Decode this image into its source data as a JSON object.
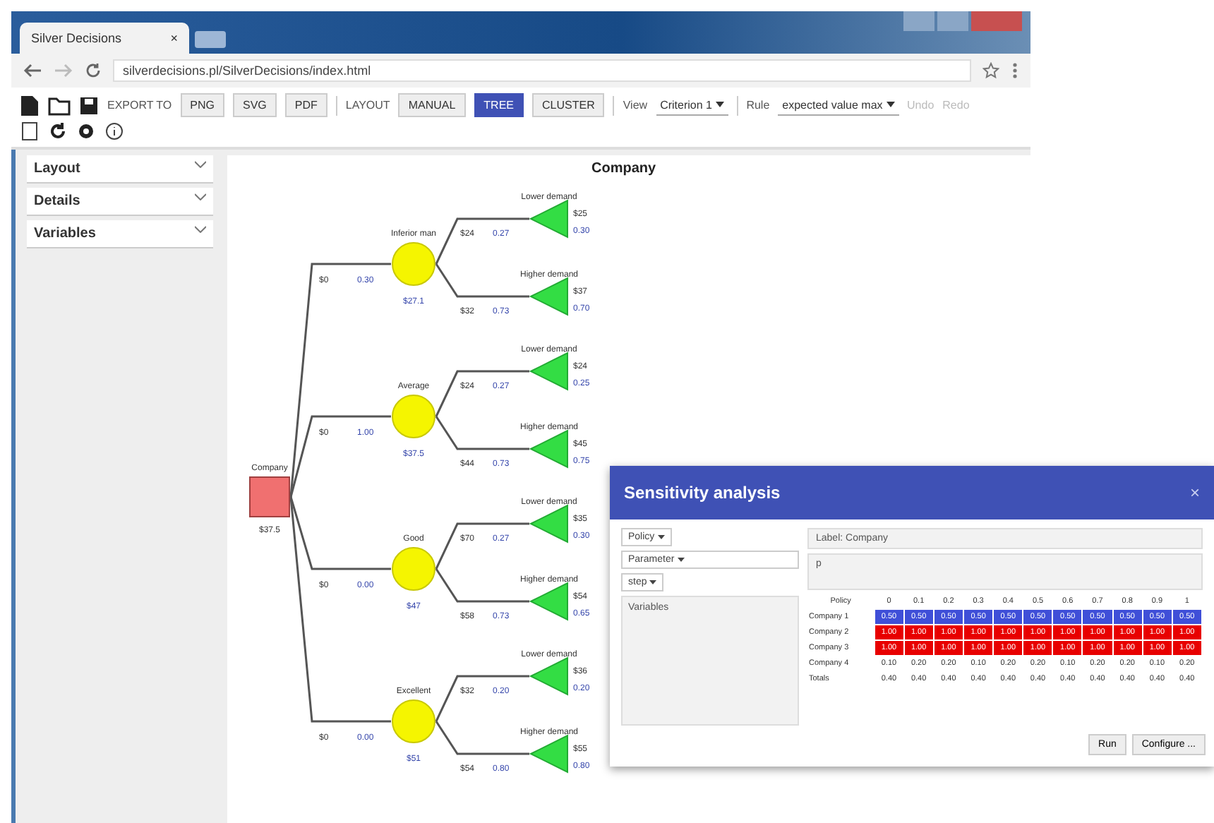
{
  "browser": {
    "tab_title": "Silver Decisions",
    "tab_close": "×",
    "address": "silverdecisions.pl/SilverDecisions/index.html"
  },
  "toolbar": {
    "export_label": "EXPORT TO",
    "export_buttons": [
      "PNG",
      "SVG",
      "PDF"
    ],
    "layout_label": "LAYOUT",
    "layout_buttons": [
      {
        "label": "MANUAL",
        "selected": false
      },
      {
        "label": "TREE",
        "selected": true
      },
      {
        "label": "CLUSTER",
        "selected": false
      }
    ],
    "view_label": "View",
    "view_value": "Criterion 1",
    "rule_label": "Rule",
    "rule_value": "expected value max",
    "undo": "Undo",
    "redo": "Redo"
  },
  "sidebar": {
    "items": [
      {
        "label": "Layout",
        "expanded": false
      },
      {
        "label": "Details",
        "expanded": false
      },
      {
        "label": "Variables",
        "expanded": false
      }
    ]
  },
  "tree": {
    "title": "Company",
    "decision": {
      "label": "Company",
      "payoff": "$37.5"
    },
    "chance_nodes": [
      {
        "label": "Inferior man",
        "payoff": "$27.1",
        "edge_label": "$0",
        "edge_value": "0.30",
        "outcomes": [
          {
            "name": "Lower demand",
            "edge_label": "$24",
            "edge_value": "0.27",
            "payoff": "$25",
            "prob": "0.30"
          },
          {
            "name": "Higher demand",
            "edge_label": "$32",
            "edge_value": "0.73",
            "payoff": "$37",
            "prob": "0.70"
          }
        ]
      },
      {
        "label": "Average",
        "payoff": "$37.5",
        "edge_label": "$0",
        "edge_value": "1.00",
        "outcomes": [
          {
            "name": "Lower demand",
            "edge_label": "$24",
            "edge_value": "0.27",
            "payoff": "$24",
            "prob": "0.25"
          },
          {
            "name": "Higher demand",
            "edge_label": "$44",
            "edge_value": "0.73",
            "payoff": "$45",
            "prob": "0.75"
          }
        ]
      },
      {
        "label": "Good",
        "payoff": "$47",
        "edge_label": "$0",
        "edge_value": "0.00",
        "outcomes": [
          {
            "name": "Lower demand",
            "edge_label": "$70",
            "edge_value": "0.27",
            "payoff": "$35",
            "prob": "0.30"
          },
          {
            "name": "Higher demand",
            "edge_label": "$58",
            "edge_value": "0.73",
            "payoff": "$54",
            "prob": "0.65"
          }
        ]
      },
      {
        "label": "Excellent",
        "payoff": "$51",
        "edge_label": "$0",
        "edge_value": "0.00",
        "outcomes": [
          {
            "name": "Lower demand",
            "edge_label": "$32",
            "edge_value": "0.20",
            "payoff": "$36",
            "prob": "0.20"
          },
          {
            "name": "Higher demand",
            "edge_label": "$54",
            "edge_value": "0.80",
            "payoff": "$55",
            "prob": "0.80"
          }
        ]
      }
    ]
  },
  "dialog": {
    "title": "Sensitivity analysis",
    "close": "×",
    "policy_select": "Policy",
    "parameter_select": "Parameter",
    "step_select": "step",
    "variables_label": "Variables",
    "label_field": "Label:",
    "label_value": "Company",
    "p_label": "p",
    "columns": [
      "Policy",
      "0",
      "0.1",
      "0.2",
      "0.3",
      "0.4",
      "0.5",
      "0.6",
      "0.7",
      "0.8",
      "0.9",
      "1"
    ],
    "rows": [
      {
        "name": "Company 1",
        "color": "#3f4fd8",
        "values": [
          "0.50",
          "0.50",
          "0.50",
          "0.50",
          "0.50",
          "0.50",
          "0.50",
          "0.50",
          "0.50",
          "0.50",
          "0.50"
        ]
      },
      {
        "name": "Company 2",
        "color": "#e80000",
        "values": [
          "1.00",
          "1.00",
          "1.00",
          "1.00",
          "1.00",
          "1.00",
          "1.00",
          "1.00",
          "1.00",
          "1.00",
          "1.00"
        ]
      },
      {
        "name": "Company 3",
        "color": "#e80000",
        "values": [
          "1.00",
          "1.00",
          "1.00",
          "1.00",
          "1.00",
          "1.00",
          "1.00",
          "1.00",
          "1.00",
          "1.00",
          "1.00"
        ]
      },
      {
        "name": "Company 4",
        "color": "#ffffff",
        "values": [
          "0.10",
          "0.20",
          "0.20",
          "0.10",
          "0.20",
          "0.20",
          "0.10",
          "0.20",
          "0.20",
          "0.10",
          "0.20"
        ]
      }
    ],
    "totals": {
      "name": "Totals",
      "values": [
        "0.40",
        "0.40",
        "0.40",
        "0.40",
        "0.40",
        "0.40",
        "0.40",
        "0.40",
        "0.40",
        "0.40",
        "0.40"
      ]
    },
    "buttons": [
      "Run",
      "Configure ..."
    ]
  }
}
